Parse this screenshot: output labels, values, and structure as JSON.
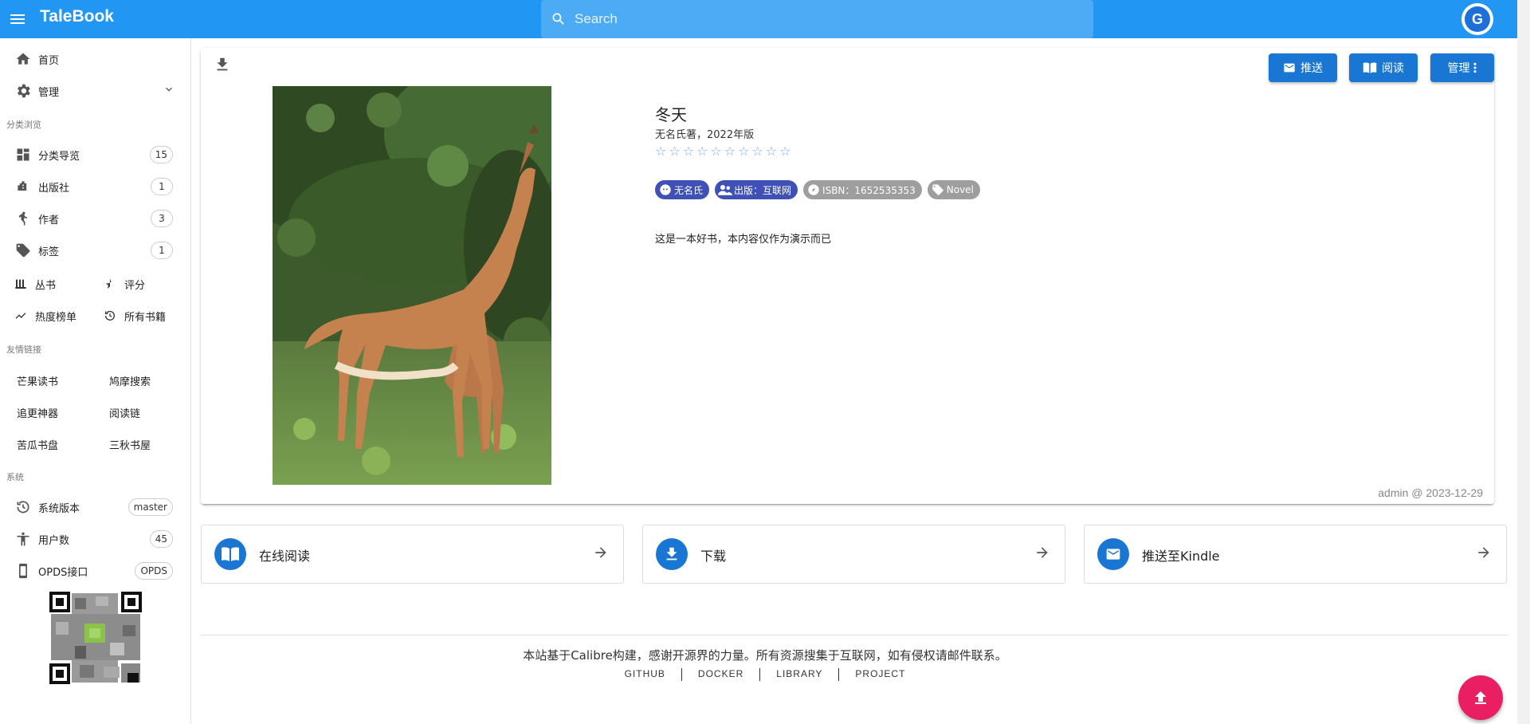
{
  "app": {
    "title": "TaleBook"
  },
  "search": {
    "placeholder": "Search"
  },
  "avatar": {
    "letter": "G"
  },
  "sidebar": {
    "home": "首页",
    "manage": "管理",
    "browse_header": "分类浏览",
    "items": [
      {
        "label": "分类导览",
        "count": "15"
      },
      {
        "label": "出版社",
        "count": "1"
      },
      {
        "label": "作者",
        "count": "3"
      },
      {
        "label": "标签",
        "count": "1"
      }
    ],
    "series": "丛书",
    "rating": "评分",
    "hot": "热度榜单",
    "all_books": "所有书籍",
    "friends_header": "友情链接",
    "links": [
      "芒果读书",
      "鸠摩搜索",
      "追更神器",
      "阅读链",
      "苦瓜书盘",
      "三秋书屋"
    ],
    "system_header": "系统",
    "system": [
      {
        "label": "系统版本",
        "value": "master"
      },
      {
        "label": "用户数",
        "value": "45"
      },
      {
        "label": "OPDS接口",
        "value": "OPDS"
      }
    ]
  },
  "book": {
    "title": "冬天",
    "subtitle": "无名氏著，2022年版",
    "stars_count": 10,
    "rating": 0,
    "chips": [
      {
        "label": "无名氏",
        "color": "#3f51b5"
      },
      {
        "label": "出版：互联网",
        "color": "#3f51b5"
      },
      {
        "label": "ISBN：1652535353",
        "color": "#9e9e9e"
      },
      {
        "label": "Novel",
        "color": "#9e9e9e"
      }
    ],
    "description": "这是一本好书，本内容仅作为演示而已",
    "meta": "admin @ 2023-12-29"
  },
  "buttons": {
    "push": "推送",
    "read": "阅读",
    "manage": "管理"
  },
  "actions": [
    {
      "label": "在线阅读"
    },
    {
      "label": "下载"
    },
    {
      "label": "推送至Kindle"
    }
  ],
  "footer": {
    "credit": "本站基于Calibre构建，感谢开源界的力量。所有资源搜集于互联网，如有侵权请邮件联系。",
    "links": [
      "GITHUB",
      "DOCKER",
      "LIBRARY",
      "PROJECT"
    ]
  },
  "colors": {
    "primary": "#2196f3",
    "button": "#1976d2",
    "fab": "#e91e63"
  }
}
